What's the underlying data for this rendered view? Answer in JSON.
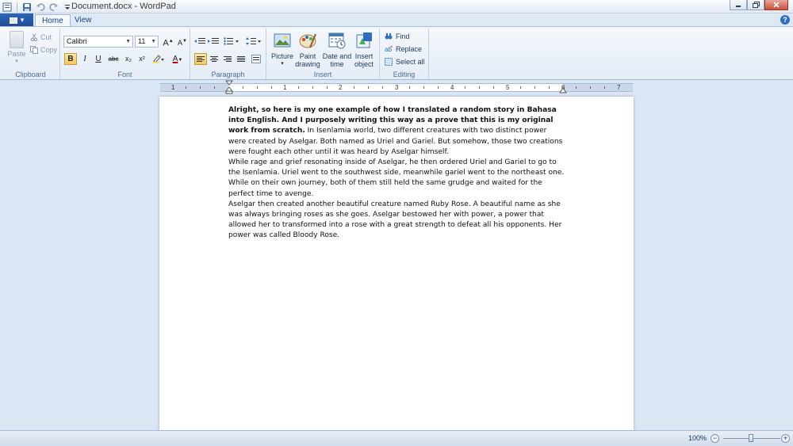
{
  "titlebar": {
    "title": "Document.docx - WordPad",
    "qat_icons": [
      "save-icon",
      "undo-icon",
      "redo-icon",
      "customize-qat-icon"
    ],
    "window_buttons": [
      "minimize-icon",
      "restore-icon",
      "close-icon"
    ]
  },
  "tabs": [
    {
      "label": "Home",
      "active": true
    },
    {
      "label": "View",
      "active": false
    }
  ],
  "ribbon": {
    "clipboard": {
      "label": "Clipboard",
      "paste": "Paste",
      "cut": "Cut",
      "copy": "Copy"
    },
    "font": {
      "label": "Font",
      "family": "Calibri",
      "size": "11",
      "grow": "A",
      "shrink": "A",
      "bold": "B",
      "italic": "I",
      "underline": "U",
      "strike": "abc",
      "subscript": "x₂",
      "superscript": "x²",
      "color_letter": "A",
      "font_color": "#c00000"
    },
    "paragraph": {
      "label": "Paragraph",
      "align_active": "left"
    },
    "insert": {
      "label": "Insert",
      "picture": "Picture",
      "paint_drawing": [
        "Paint",
        "drawing"
      ],
      "date_time": [
        "Date and",
        "time"
      ],
      "insert_object": [
        "Insert",
        "object"
      ]
    },
    "editing": {
      "label": "Editing",
      "find": "Find",
      "replace": "Replace",
      "select_all": "Select all"
    }
  },
  "ruler": {
    "labels": [
      "1",
      "1",
      "2",
      "3",
      "4",
      "5",
      "6",
      "7"
    ]
  },
  "document": {
    "bold_intro": "Alright, so here is my one example of how I translated a random story in Bahasa into English. And I purposely writing this way as a prove that this is my original work from scratch.",
    "para1_rest": " In Isenlamia world, two different creatures with two distinct power were created by Aselgar. Both named as Uriel and Gariel. But somehow, those two creations were fought each other until it was heard by Aselgar himself.",
    "para2": "While rage and grief resonating inside of Aselgar, he then ordered Uriel and Gariel to go to the Isenlamia. Uriel went to the southwest side, meanwhile gariel went to the northeast one. While on their own journey, both of them still held the same grudge and waited for the perfect time to avenge.",
    "para3": "Aselgar then created another beautiful creature named Ruby Rose. A beautiful name as she was always bringing roses as she goes. Aselgar bestowed her with power, a power that allowed her to transformed into a rose with a great strength to defeat all his opponents. Her power was called Bloody Rose."
  },
  "statusbar": {
    "zoom": "100%",
    "zoom_out": "−",
    "zoom_in": "+",
    "zoom_fraction": 0.48
  }
}
